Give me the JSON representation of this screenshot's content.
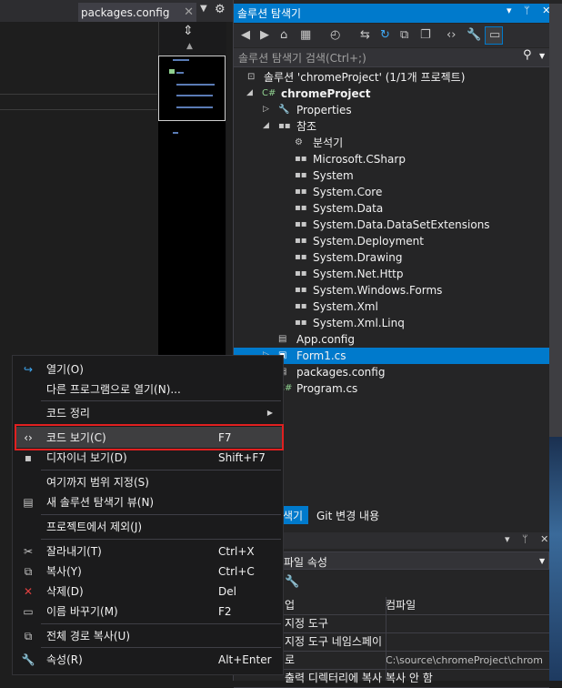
{
  "editor": {
    "tab_label": "packages.config",
    "tab_close": "✕",
    "tab_dropdown": "▼",
    "settings": "⚙"
  },
  "solution_explorer": {
    "title": "솔루션 탐색기",
    "title_buttons": "▾ ᛘ ✕",
    "search_placeholder": "솔루션 탐색기 검색(Ctrl+;)",
    "tree": [
      {
        "label": "솔루션 'chromeProject' (1/1개 프로젝트)",
        "bold": false
      },
      {
        "label": "chromeProject",
        "bold": true
      },
      {
        "label": "Properties",
        "bold": false
      },
      {
        "label": "참조",
        "bold": false
      },
      {
        "label": "분석기",
        "bold": false
      },
      {
        "label": "Microsoft.CSharp",
        "bold": false
      },
      {
        "label": "System",
        "bold": false
      },
      {
        "label": "System.Core",
        "bold": false
      },
      {
        "label": "System.Data",
        "bold": false
      },
      {
        "label": "System.Data.DataSetExtensions",
        "bold": false
      },
      {
        "label": "System.Deployment",
        "bold": false
      },
      {
        "label": "System.Drawing",
        "bold": false
      },
      {
        "label": "System.Net.Http",
        "bold": false
      },
      {
        "label": "System.Windows.Forms",
        "bold": false
      },
      {
        "label": "System.Xml",
        "bold": false
      },
      {
        "label": "System.Xml.Linq",
        "bold": false
      },
      {
        "label": "App.config",
        "bold": false
      },
      {
        "label": "Form1.cs",
        "bold": false
      },
      {
        "label": "packages.config",
        "bold": false
      },
      {
        "label": "Program.cs",
        "bold": false
      }
    ],
    "tab_solution": "색기",
    "tab_git": "Git 변경 내용"
  },
  "properties": {
    "title_buttons": "▾ ᛘ ✕",
    "combo": "파일 속성",
    "rows": [
      {
        "name": "업",
        "value": "컴파일"
      },
      {
        "name": "지정 도구",
        "value": ""
      },
      {
        "name": "지정 도구 네임스페이",
        "value": ""
      },
      {
        "name": "로",
        "value": "C:\\source\\chromeProject\\chrom"
      },
      {
        "name": "출력 디렉터리에 복사",
        "value": "복사 안 함"
      }
    ]
  },
  "context_menu": {
    "items": [
      {
        "label": "열기(O)",
        "shortcut": "",
        "icon": "open-icon"
      },
      {
        "label": "다른 프로그램으로 열기(N)...",
        "shortcut": "",
        "icon": ""
      },
      {
        "label": "코드 정리",
        "shortcut": "",
        "icon": ""
      },
      {
        "label": "코드 보기(C)",
        "shortcut": "F7",
        "icon": "code-icon"
      },
      {
        "label": "디자이너 보기(D)",
        "shortcut": "Shift+F7",
        "icon": "designer-icon"
      },
      {
        "label": "여기까지 범위 지정(S)",
        "shortcut": "",
        "icon": ""
      },
      {
        "label": "새 솔루션 탐색기 뷰(N)",
        "shortcut": "",
        "icon": "new-view-icon"
      },
      {
        "label": "프로젝트에서 제외(J)",
        "shortcut": "",
        "icon": ""
      },
      {
        "label": "잘라내기(T)",
        "shortcut": "Ctrl+X",
        "icon": "scissors-icon"
      },
      {
        "label": "복사(Y)",
        "shortcut": "Ctrl+C",
        "icon": "copy-icon"
      },
      {
        "label": "삭제(D)",
        "shortcut": "Del",
        "icon": "delete-icon"
      },
      {
        "label": "이름 바꾸기(M)",
        "shortcut": "F2",
        "icon": "rename-icon"
      },
      {
        "label": "전체 경로 복사(U)",
        "shortcut": "",
        "icon": "copy-path-icon"
      },
      {
        "label": "속성(R)",
        "shortcut": "Alt+Enter",
        "icon": "wrench-icon"
      }
    ]
  }
}
